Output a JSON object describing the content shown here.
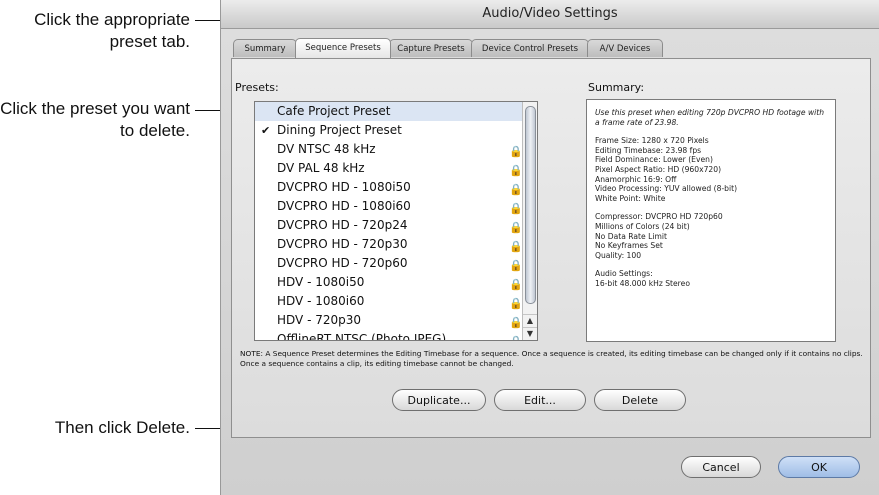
{
  "callouts": {
    "c1": "Click the appropriate preset tab.",
    "c2": "Click the preset you want to delete.",
    "c3": "Then click Delete."
  },
  "window": {
    "title": "Audio/Video Settings"
  },
  "tabs": [
    "Summary",
    "Sequence Presets",
    "Capture Presets",
    "Device Control Presets",
    "A/V Devices"
  ],
  "presets": {
    "label": "Presets:",
    "items": [
      {
        "name": "Cafe Project Preset",
        "selected": true,
        "checked": false,
        "locked": false
      },
      {
        "name": "Dining Project Preset",
        "selected": false,
        "checked": true,
        "locked": false
      },
      {
        "name": "DV NTSC 48 kHz",
        "selected": false,
        "checked": false,
        "locked": true
      },
      {
        "name": "DV PAL 48 kHz",
        "selected": false,
        "checked": false,
        "locked": true
      },
      {
        "name": "DVCPRO HD - 1080i50",
        "selected": false,
        "checked": false,
        "locked": true
      },
      {
        "name": "DVCPRO HD - 1080i60",
        "selected": false,
        "checked": false,
        "locked": true
      },
      {
        "name": "DVCPRO HD - 720p24",
        "selected": false,
        "checked": false,
        "locked": true
      },
      {
        "name": "DVCPRO HD - 720p30",
        "selected": false,
        "checked": false,
        "locked": true
      },
      {
        "name": "DVCPRO HD - 720p60",
        "selected": false,
        "checked": false,
        "locked": true
      },
      {
        "name": "HDV - 1080i50",
        "selected": false,
        "checked": false,
        "locked": true
      },
      {
        "name": "HDV - 1080i60",
        "selected": false,
        "checked": false,
        "locked": true
      },
      {
        "name": "HDV - 720p30",
        "selected": false,
        "checked": false,
        "locked": true
      },
      {
        "name": "OfflineRT NTSC (Photo JPEG)",
        "selected": false,
        "checked": false,
        "locked": true
      }
    ]
  },
  "summary": {
    "label": "Summary:",
    "intro": "Use this preset when editing 720p DVCPRO HD footage with a frame rate of 23.98.",
    "block1": [
      "Frame Size: 1280 x 720 Pixels",
      "Editing Timebase: 23.98 fps",
      "Field Dominance: Lower (Even)",
      "Pixel Aspect Ratio: HD (960x720)",
      "Anamorphic 16:9: Off",
      "Video Processing: YUV allowed (8-bit)",
      "White Point: White"
    ],
    "block2": [
      "Compressor: DVCPRO HD 720p60",
      "Millions of Colors (24 bit)",
      "No Data Rate Limit",
      "No Keyframes Set",
      "Quality: 100"
    ],
    "block3": [
      "Audio Settings:",
      "16-bit 48.000 kHz Stereo"
    ]
  },
  "note": "NOTE: A Sequence Preset determines the Editing Timebase for a sequence. Once a sequence is created, its editing timebase can be changed only if it contains no clips. Once a sequence contains a clip, its editing timebase cannot be changed.",
  "buttons": {
    "duplicate": "Duplicate...",
    "edit": "Edit...",
    "delete": "Delete",
    "cancel": "Cancel",
    "ok": "OK"
  },
  "icons": {
    "check": "checkmark-icon",
    "lock": "lock-icon"
  }
}
